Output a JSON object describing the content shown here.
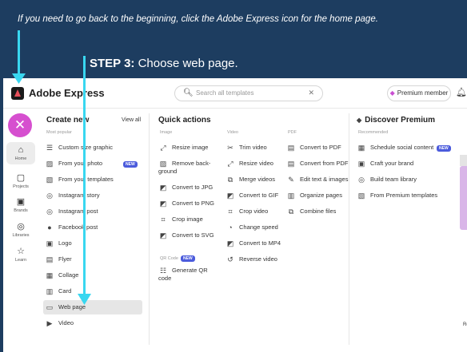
{
  "caption": "If you need to go back to the beginning, click the Adobe Express icon for the home page.",
  "step": {
    "bold": "STEP 3:",
    "text": "Choose web page."
  },
  "topbar": {
    "brand": "Adobe Express",
    "search_placeholder": "Search all templates",
    "premium_label": "Premium member"
  },
  "rail": [
    {
      "label": "Home",
      "icon": "home-icon"
    },
    {
      "label": "Projects",
      "icon": "folder-icon"
    },
    {
      "label": "Brands",
      "icon": "brand-icon"
    },
    {
      "label": "Libraries",
      "icon": "cloud-icon"
    },
    {
      "label": "Learn",
      "icon": "lightbulb-icon"
    }
  ],
  "create_new": {
    "title": "Create new",
    "view_all": "View all",
    "subtitle": "Most popular",
    "items": [
      {
        "label": "Custom size graphic",
        "icon": "sliders-icon"
      },
      {
        "label": "From your photo",
        "icon": "photo-icon",
        "badge": "NEW"
      },
      {
        "label": "From your templates",
        "icon": "templates-icon"
      },
      {
        "label": "Instagram story",
        "icon": "instagram-icon"
      },
      {
        "label": "Instagram post",
        "icon": "instagram-icon"
      },
      {
        "label": "Facebook post",
        "icon": "facebook-icon"
      },
      {
        "label": "Logo",
        "icon": "logo-icon"
      },
      {
        "label": "Flyer",
        "icon": "flyer-icon"
      },
      {
        "label": "Collage",
        "icon": "collage-icon"
      },
      {
        "label": "Card",
        "icon": "card-icon"
      },
      {
        "label": "Web page",
        "icon": "webpage-icon"
      },
      {
        "label": "Video",
        "icon": "video-icon"
      }
    ]
  },
  "quick_actions": {
    "title": "Quick actions",
    "image": {
      "subtitle": "Image",
      "items": [
        "Resize image",
        "Remove back- ground",
        "Convert to JPG",
        "Convert to PNG",
        "Crop image",
        "Convert to SVG"
      ]
    },
    "qr": {
      "subtitle": "QR Code",
      "badge": "NEW",
      "items": [
        "Generate QR code"
      ]
    },
    "video": {
      "subtitle": "Video",
      "items": [
        "Trim video",
        "Resize video",
        "Merge videos",
        "Convert to GIF",
        "Crop video",
        "Change speed",
        "Convert to MP4",
        "Reverse video"
      ]
    },
    "pdf": {
      "subtitle": "PDF",
      "items": [
        "Convert to PDF",
        "Convert from PDF",
        "Edit text & images",
        "Organize pages",
        "Combine files"
      ]
    }
  },
  "premium": {
    "title": "Discover Premium",
    "subtitle": "Recommended",
    "items": [
      {
        "label": "Schedule social content",
        "badge": "NEW"
      },
      {
        "label": "Craft your brand"
      },
      {
        "label": "Build team library"
      },
      {
        "label": "From Premium templates"
      }
    ]
  },
  "edge_text": "Re",
  "colors": {
    "background": "#1d3d60",
    "arrow": "#39d7f0",
    "accent": "#d64fcf",
    "badge": "#4b5bdc"
  }
}
